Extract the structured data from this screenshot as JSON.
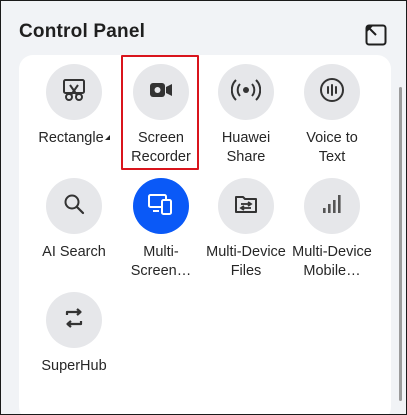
{
  "header": {
    "title": "Control Panel"
  },
  "tiles": [
    {
      "label": "Rectangle",
      "icon": "scissors-screenshot-icon",
      "active": false
    },
    {
      "label": "Screen\nRecorder",
      "icon": "video-camera-icon",
      "active": false
    },
    {
      "label": "Huawei\nShare",
      "icon": "wireless-share-icon",
      "active": false
    },
    {
      "label": "Voice to\nText",
      "icon": "voice-wave-icon",
      "active": false
    },
    {
      "label": "AI Search",
      "icon": "search-icon",
      "active": false
    },
    {
      "label": "Multi-\nScreen…",
      "icon": "multi-screen-icon",
      "active": true
    },
    {
      "label": "Multi-Device\nFiles",
      "icon": "folder-transfer-icon",
      "active": false
    },
    {
      "label": "Multi-Device\nMobile…",
      "icon": "signal-bars-icon",
      "active": false
    },
    {
      "label": "SuperHub",
      "icon": "superhub-icon",
      "active": false
    }
  ],
  "colors": {
    "accent": "#0a59f7",
    "highlight": "#d9141c",
    "tile_bg": "#e6e7ea",
    "panel_bg": "#f1f3f6"
  }
}
